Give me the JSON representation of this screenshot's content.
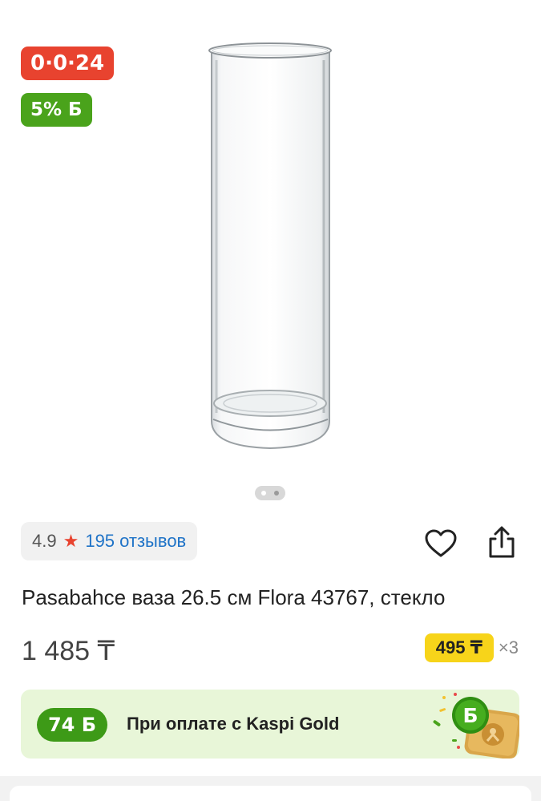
{
  "gallery": {
    "installment_badge": "0·0·24",
    "bonus_badge": "5% Б",
    "image_icon": "glass-vase",
    "pager": {
      "count": 2,
      "active": 2
    }
  },
  "rating": {
    "value": "4.9",
    "star_icon": "star-icon",
    "reviews_label": "195 отзывов"
  },
  "actions": {
    "favorite_icon": "heart-icon",
    "share_icon": "share-icon"
  },
  "product": {
    "title": "Pasabahce ваза 26.5 см Flora 43767, стекло",
    "price": "1 485 ₸",
    "monthly_payment": "495 ₸",
    "monthly_multiplier": "×3"
  },
  "kaspi_gold": {
    "bonus_amount": "74 Б",
    "label": "При оплате с Kaspi Gold",
    "art_icon": "kaspi-gold-card-illustration"
  },
  "colors": {
    "installment_red": "#e8432f",
    "bonus_green": "#4aa31b",
    "monthly_yellow": "#f7d41a",
    "link_blue": "#1f73c7",
    "banner_bg": "#e8f6d8"
  }
}
